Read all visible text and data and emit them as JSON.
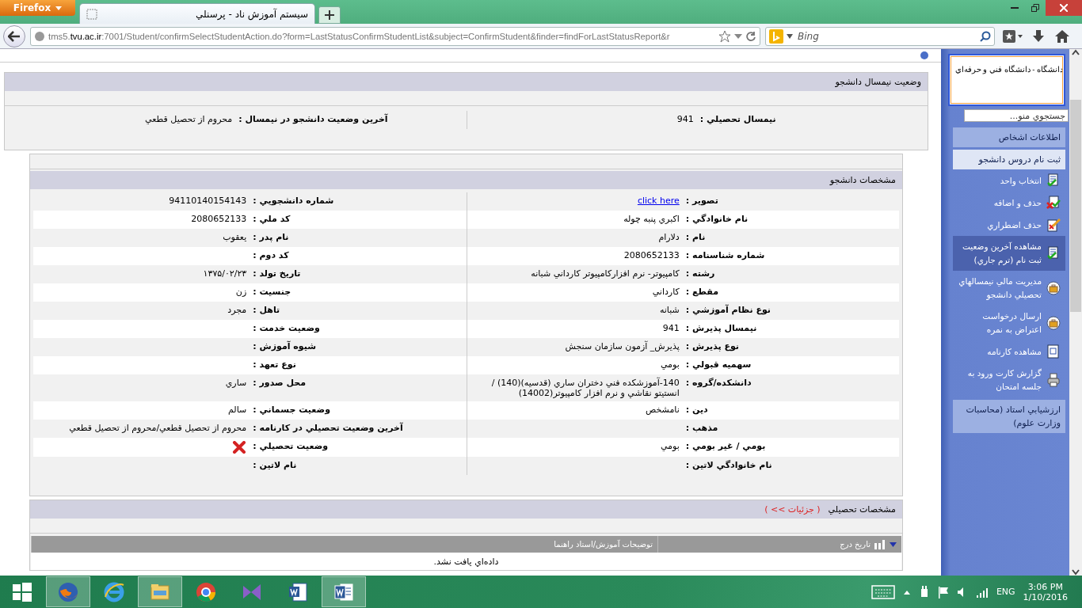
{
  "browser": {
    "menu_button": "Firefox",
    "tab_title": "سیستم آموزش ناد - پرسنلي",
    "url": "tms5.**tvu.ac.ir**:7001/Student/confirmSelectStudentAction.do?form=LastStatusConfirmStudentList&subject=ConfirmStudent&finder=findForLastStatusReport&r",
    "search_placeholder": "Bing"
  },
  "status_panel": {
    "title": "وضعيت نيمسال دانشجو",
    "fields": [
      {
        "label": "نيمسال تحصيلي :",
        "value": "941"
      },
      {
        "label": "آخرين وضعيت دانشجو در نيمسال :",
        "value": "محروم از تحصيل قطعي"
      }
    ]
  },
  "student_panel": {
    "title": "مشخصات دانشجو",
    "rows": [
      [
        {
          "label": "تصوير :",
          "kind": "link",
          "value": "click here"
        },
        {
          "label": "شماره دانشجويي :",
          "kind": "text",
          "value": "94110140154143"
        }
      ],
      [
        {
          "label": "نام خانوادگي :",
          "kind": "text",
          "value": "اكبري پنبه چوله"
        },
        {
          "label": "كد ملي :",
          "kind": "text",
          "value": "2080652133"
        }
      ],
      [
        {
          "label": "نام :",
          "kind": "text",
          "value": "دلارام"
        },
        {
          "label": "نام پدر :",
          "kind": "text",
          "value": "يعقوب"
        }
      ],
      [
        {
          "label": "شماره شناسنامه :",
          "kind": "text",
          "value": "2080652133"
        },
        {
          "label": "كد دوم :",
          "kind": "text"
        }
      ],
      [
        {
          "label": "رشته :",
          "kind": "text",
          "value": "كامپيوتر- نرم افزاركامپيوتر كارداني شبانه"
        },
        {
          "label": "تاريخ تولد :",
          "kind": "text",
          "value": "۱۳۷۵/۰۲/۲۳"
        }
      ],
      [
        {
          "label": "مقطع :",
          "kind": "text",
          "value": "كارداني"
        },
        {
          "label": "جنسيت :",
          "kind": "text",
          "value": "زن"
        }
      ],
      [
        {
          "label": "نوع نظام آموزشي :",
          "kind": "text",
          "value": "شبانه"
        },
        {
          "label": "تاهل :",
          "kind": "text",
          "value": "مجرد"
        }
      ],
      [
        {
          "label": "نيمسال پذيرش :",
          "kind": "text",
          "value": "941"
        },
        {
          "label": "وضعيت خدمت :",
          "kind": "text"
        }
      ],
      [
        {
          "label": "نوع پذيرش :",
          "kind": "text",
          "value": "پذيرش_ آزمون سازمان سنجش"
        },
        {
          "label": "شيوه آموزش :",
          "kind": "text"
        }
      ],
      [
        {
          "label": "سهميه قبولي :",
          "kind": "text",
          "value": "بومي"
        },
        {
          "label": "نوع تعهد :",
          "kind": "text"
        }
      ],
      [
        {
          "label": "دانشكده/گروه :",
          "kind": "text",
          "value": "140-آموزشكده فني دختران ساري (قدسيه)(140) / انستيتو نقاشي و نرم افزار كامپيوتر(14002)"
        },
        {
          "label": "محل صدور :",
          "kind": "text",
          "value": "ساري"
        }
      ],
      [
        {
          "label": "دين :",
          "kind": "text",
          "value": "نامشخص"
        },
        {
          "label": "وضعيت جسماني :",
          "kind": "text",
          "value": "سالم"
        }
      ],
      [
        {
          "label": "مذهب :",
          "kind": "text"
        },
        {
          "label": "آخرين وضعيت تحصيلي در كارنامه :",
          "kind": "text",
          "value": "محروم از تحصيل قطعي/محروم از تحصيل قطعي"
        }
      ],
      [
        {
          "label": "بومي / غير بومي :",
          "kind": "text",
          "value": "بومي"
        },
        {
          "label": "وضعيت تحصيلي :",
          "kind": "status",
          "passed": false
        }
      ],
      [
        {
          "label": "نام خانوادگي لاتين :",
          "kind": "text"
        },
        {
          "label": "نام لاتين :",
          "kind": "text"
        }
      ]
    ]
  },
  "academic_panel": {
    "title": "مشخصات تحصيلي",
    "details_link": "( جزئيات >> )",
    "columns": [
      "تاريخ درج",
      "توضيحات آموزش/استاد راهنما"
    ],
    "empty_message": "داده‌اي يافت نشد."
  },
  "sidebar": {
    "university": "دانشگاه - دانشگاه فني و حرفه‌اي",
    "search_placeholder": "جستجوي منو...",
    "items": [
      {
        "kind": "section",
        "label": "اطلاعات اشخاص",
        "selected": false
      },
      {
        "kind": "section",
        "label": "ثبت نام دروس دانشجو",
        "selected": true
      },
      {
        "kind": "link",
        "label": "انتخاب واحد",
        "selected": false
      },
      {
        "kind": "link",
        "label": "حذف و اضافه",
        "selected": false
      },
      {
        "kind": "link",
        "label": "حذف اضطراري",
        "selected": false
      },
      {
        "kind": "link",
        "label": "مشاهده آخرين وضعيت ثبت نام (ترم جاري)",
        "selected": true
      },
      {
        "kind": "link",
        "label": "مديريت مالي نيمسالهاي تحصيلي دانشجو",
        "selected": false
      },
      {
        "kind": "link",
        "label": "ارسال درخواست اعتراض به نمره",
        "selected": false
      },
      {
        "kind": "link",
        "label": "مشاهده كارنامه",
        "selected": false
      },
      {
        "kind": "link",
        "label": "گزارش كارت ورود به جلسه امتحان",
        "selected": false
      },
      {
        "kind": "section",
        "label": "ارزشيابي استاد (محاسبات وزارت علوم)",
        "selected": false
      }
    ]
  },
  "taskbar": {
    "apps": [
      {
        "selected": true
      },
      {
        "selected": false
      },
      {
        "selected": true
      },
      {
        "selected": false
      },
      {
        "selected": false
      },
      {
        "selected": false
      },
      {
        "selected": true
      }
    ],
    "language": "ENG",
    "time": "3:06 PM",
    "date": "1/10/2016"
  }
}
